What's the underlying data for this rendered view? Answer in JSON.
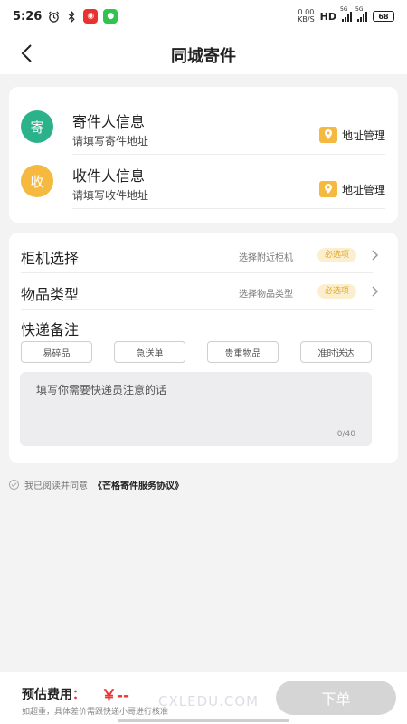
{
  "status_bar": {
    "time": "5:26",
    "net_speed_value": "0.00",
    "net_speed_unit": "KB/S",
    "hd": "HD",
    "signal_label_1": "5G",
    "signal_label_2": "5G",
    "battery": "68"
  },
  "nav": {
    "title": "同城寄件"
  },
  "sender": {
    "badge": "寄",
    "title": "寄件人信息",
    "subtitle": "请填写寄件地址",
    "manage": "地址管理"
  },
  "receiver": {
    "badge": "收",
    "title": "收件人信息",
    "subtitle": "请填写收件地址",
    "manage": "地址管理"
  },
  "form": {
    "cabinet": {
      "label": "柜机选择",
      "hint": "选择附近柜机",
      "tag": "必选项"
    },
    "item_type": {
      "label": "物品类型",
      "hint": "选择物品类型",
      "tag": "必选项"
    },
    "remark_label": "快递备注",
    "chips": [
      "易碎品",
      "急送单",
      "贵重物品",
      "准时送达"
    ],
    "remark_placeholder": "填写你需要快递员注意的话",
    "counter": "0/40"
  },
  "agreement": {
    "prefix": "我已阅读并同意",
    "link": "《芒格寄件服务协议》"
  },
  "bottom": {
    "fee_label": "预估费用",
    "fee_colon": "：",
    "fee_value": "￥--",
    "fee_note": "如超重，具体差价需跟快递小哥进行核准",
    "order_button": "下单",
    "watermark": "CXLEDU.COM"
  },
  "colors": {
    "green": "#2cb28a",
    "yellow": "#f5b940",
    "red": "#e33333",
    "tag_bg": "#fcefd0"
  }
}
